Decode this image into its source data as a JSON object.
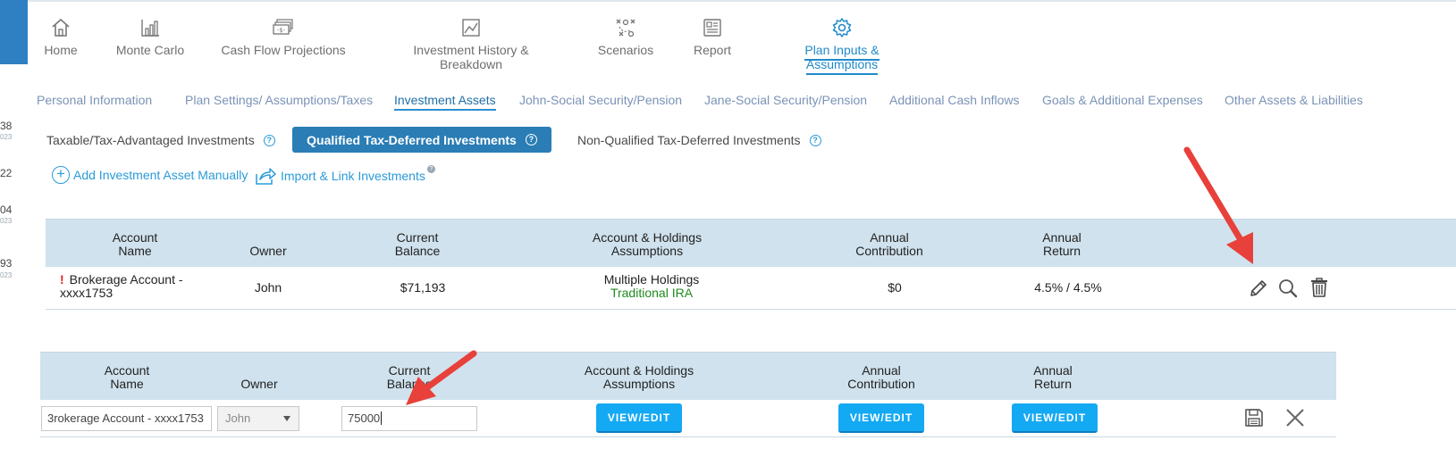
{
  "colors": {
    "accent": "#1f8ac9",
    "header_bg": "#d0e2ed",
    "primary_button": "#2a7db5",
    "view_edit_button": "#14a9f3",
    "warning": "#e0201c",
    "account_type": "#1e8a1e",
    "annotation_arrow": "#e8403a"
  },
  "side_numbers": [
    {
      "value": "38",
      "sub": "023"
    },
    {
      "value": "22",
      "sub": ""
    },
    {
      "value": "04",
      "sub": "023"
    },
    {
      "value": "93",
      "sub": "023"
    }
  ],
  "main_nav": [
    {
      "label": "Home",
      "icon": "home-icon"
    },
    {
      "label": "Monte Carlo",
      "icon": "bar-chart-icon"
    },
    {
      "label": "Cash Flow Projections",
      "icon": "cash-icon"
    },
    {
      "label": "Investment History & Breakdown",
      "icon": "line-chart-icon"
    },
    {
      "label": "Scenarios",
      "icon": "strategy-icon"
    },
    {
      "label": "Report",
      "icon": "report-icon"
    },
    {
      "label": "Plan Inputs & Assumptions",
      "icon": "gear-icon",
      "active": true
    }
  ],
  "sub_tabs": [
    {
      "label": "Personal Information"
    },
    {
      "label": "Plan Settings/ Assumptions/Taxes"
    },
    {
      "label": "Investment Assets",
      "active": true
    },
    {
      "label": "John-Social Security/Pension"
    },
    {
      "label": "Jane-Social Security/Pension"
    },
    {
      "label": "Additional Cash Inflows"
    },
    {
      "label": "Goals & Additional Expenses"
    },
    {
      "label": "Other Assets & Liabilities"
    }
  ],
  "investment_types": [
    {
      "label": "Taxable/Tax-Advantaged Investments"
    },
    {
      "label": "Qualified Tax-Deferred Investments",
      "active": true
    },
    {
      "label": "Non-Qualified Tax-Deferred Investments"
    }
  ],
  "actions": {
    "add_manual": "Add Investment Asset Manually",
    "import_link": "Import & Link Investments"
  },
  "table_headers": {
    "account_name_1": "Account",
    "account_name_2": "Name",
    "owner": "Owner",
    "current_balance_1": "Current",
    "current_balance_2": "Balance",
    "assumptions_1": "Account & Holdings",
    "assumptions_2": "Assumptions",
    "annual_contribution_1": "Annual",
    "annual_contribution_2": "Contribution",
    "annual_return_1": "Annual",
    "annual_return_2": "Return"
  },
  "account_row": {
    "name_line1": "Brokerage Account -",
    "name_line2": "xxxx1753",
    "owner": "John",
    "current_balance": "$71,193",
    "holdings": "Multiple Holdings",
    "account_type": "Traditional IRA",
    "annual_contribution": "$0",
    "annual_return": "4.5% / 4.5%",
    "warning_mark": "!"
  },
  "edit_row": {
    "account_name_value": "3rokerage Account - xxxx1753",
    "owner_selected": "John",
    "current_balance_value": "75000",
    "view_edit_label": "VIEW/EDIT"
  }
}
